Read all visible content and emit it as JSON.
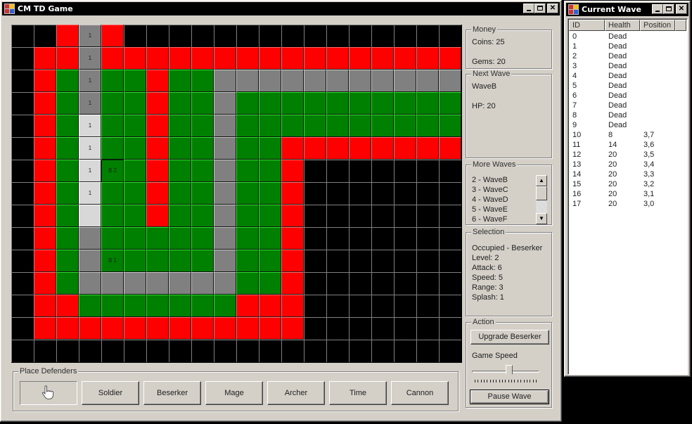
{
  "main_window": {
    "title": "CM TD Game",
    "buttons": {
      "minimize": "minimize",
      "maximize": "maximize",
      "close": "close"
    }
  },
  "grid": {
    "columns": 20,
    "rows": 15,
    "legend": {
      "B": "empty/black",
      "R": "red border",
      "G": "green buildable",
      "P": "path gray",
      "L": "path light"
    },
    "colors": {
      "B": "#000000",
      "R": "#ff0000",
      "G": "#008000",
      "P": "#808080",
      "L": "#d8d8d8"
    },
    "cells": [
      "BBRPRBBBBBBBBBBBBBBB",
      "BRRPRRRRRRRRRRRRRRRR",
      "BRGPGGRGGPPPPPPPPPPP",
      "BRGPGGRGGPGGGGGGGGGG",
      "BRGLGGRGGPGGGGGGGGGG",
      "BRGLGGRGGPGGRRRRRRRR",
      "BRGLGGRGGPGGRBBBBBBB",
      "BRGLGGRGGPGGRBBBBBBB",
      "BRGLGGRGGPGGRBBBBBBB",
      "BRGPGGGGGPGGRBBBBBBB",
      "BRGPGGGGGPGGRBBBBBBB",
      "BRGPPPPPPPGGRBBBBBBB",
      "BRRGGGGGGGRRRBBBBBBB",
      "BRRRRRRRRRRRRBBBBBBB",
      "BBBBBBBBBBBBBBBBBBBB"
    ],
    "labels": [
      {
        "row": 0,
        "col": 3,
        "text": "1"
      },
      {
        "row": 1,
        "col": 3,
        "text": "1"
      },
      {
        "row": 2,
        "col": 3,
        "text": "1"
      },
      {
        "row": 3,
        "col": 3,
        "text": "1"
      },
      {
        "row": 4,
        "col": 3,
        "text": "1"
      },
      {
        "row": 5,
        "col": 3,
        "text": "1"
      },
      {
        "row": 6,
        "col": 3,
        "text": "1"
      },
      {
        "row": 7,
        "col": 3,
        "text": "1"
      },
      {
        "row": 6,
        "col": 4,
        "text": "B 2",
        "selected": true
      },
      {
        "row": 10,
        "col": 4,
        "text": "B 1"
      }
    ]
  },
  "money": {
    "legend": "Money",
    "coins": "Coins: 25",
    "gems": "Gems: 20"
  },
  "next_wave": {
    "legend": "Next Wave",
    "name": "WaveB",
    "hp": "HP: 20"
  },
  "more_waves": {
    "legend": "More Waves",
    "items": [
      "2 - WaveB",
      "3 - WaveC",
      "4 - WaveD",
      "5 - WaveE",
      "6 - WaveF"
    ]
  },
  "selection": {
    "legend": "Selection",
    "lines": [
      "Occupied - Beserker",
      "Level: 2",
      "Attack: 6",
      "Speed: 5",
      "Range: 3",
      "Splash: 1"
    ]
  },
  "action": {
    "legend": "Action",
    "upgrade_label": "Upgrade Beserker",
    "game_speed_label": "Game Speed",
    "game_speed_value": 0.55,
    "pause_label": "Pause Wave"
  },
  "place_defenders": {
    "legend": "Place Defenders",
    "pointer_icon": "hand-pointer-icon",
    "buttons": [
      "Soldier",
      "Beserker",
      "Mage",
      "Archer",
      "Time",
      "Cannon"
    ]
  },
  "wave_window": {
    "title": "Current Wave",
    "columns": [
      "ID",
      "Health",
      "Position"
    ],
    "rows": [
      [
        "0",
        "Dead",
        ""
      ],
      [
        "1",
        "Dead",
        ""
      ],
      [
        "2",
        "Dead",
        ""
      ],
      [
        "3",
        "Dead",
        ""
      ],
      [
        "4",
        "Dead",
        ""
      ],
      [
        "5",
        "Dead",
        ""
      ],
      [
        "6",
        "Dead",
        ""
      ],
      [
        "7",
        "Dead",
        ""
      ],
      [
        "8",
        "Dead",
        ""
      ],
      [
        "9",
        "Dead",
        ""
      ],
      [
        "10",
        "8",
        "3,7"
      ],
      [
        "11",
        "14",
        "3,6"
      ],
      [
        "12",
        "20",
        "3,5"
      ],
      [
        "13",
        "20",
        "3,4"
      ],
      [
        "14",
        "20",
        "3,3"
      ],
      [
        "15",
        "20",
        "3,2"
      ],
      [
        "16",
        "20",
        "3,1"
      ],
      [
        "17",
        "20",
        "3,0"
      ]
    ]
  }
}
